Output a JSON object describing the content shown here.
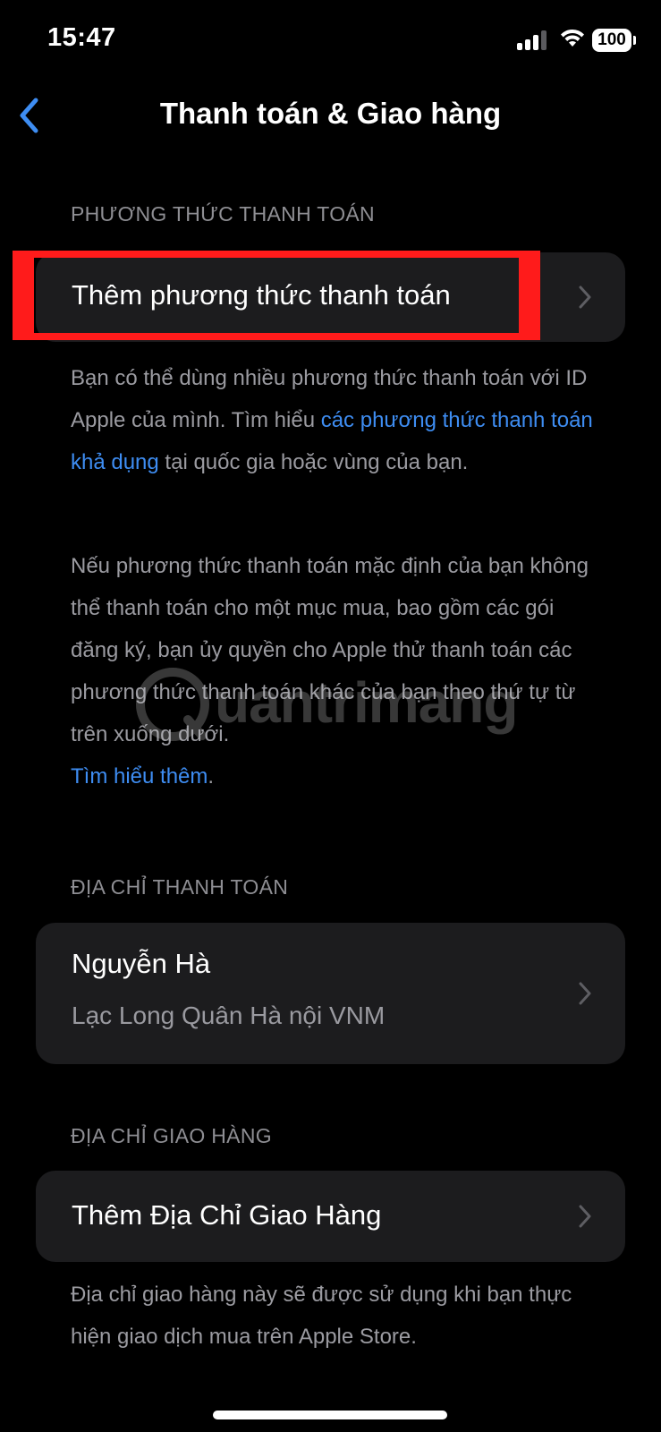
{
  "status_bar": {
    "time": "15:47",
    "battery": "100"
  },
  "nav": {
    "back_icon": "chevron-left-icon",
    "title": "Thanh toán & Giao hàng"
  },
  "payment": {
    "header": "PHƯƠNG THỨC THANH TOÁN",
    "add_label": "Thêm phương thức thanh toán",
    "footer1_a": "Bạn có thể dùng nhiều phương thức thanh toán với ID Apple của mình. Tìm hiểu ",
    "footer1_link": "các phương thức thanh toán khả dụng",
    "footer1_b": " tại quốc gia hoặc vùng của bạn.",
    "footer2": "Nếu phương thức thanh toán mặc định của bạn không thể thanh toán cho một mục mua, bao gồm các gói đăng ký, bạn ủy quyền cho Apple thử thanh toán các phương thức thanh toán khác của bạn theo thứ tự từ trên xuống dưới.",
    "learn_more": "Tìm hiểu thêm",
    "learn_more_period": "."
  },
  "billing": {
    "header": "ĐỊA CHỈ THANH TOÁN",
    "name": "Nguyễn Hà",
    "address": "Lạc Long Quân Hà nội VNM"
  },
  "shipping": {
    "header": "ĐỊA CHỈ GIAO HÀNG",
    "add_label": "Thêm Địa Chỉ Giao Hàng",
    "footer": "Địa chỉ giao hàng này sẽ được sử dụng khi bạn thực hiện giao dịch mua trên Apple Store."
  },
  "watermark": {
    "text": "uantrimang"
  },
  "colors": {
    "accent": "#3e8df2",
    "highlight": "#ff1b1b",
    "cell": "#1c1c1e",
    "secondary_text": "#8e8e93"
  }
}
